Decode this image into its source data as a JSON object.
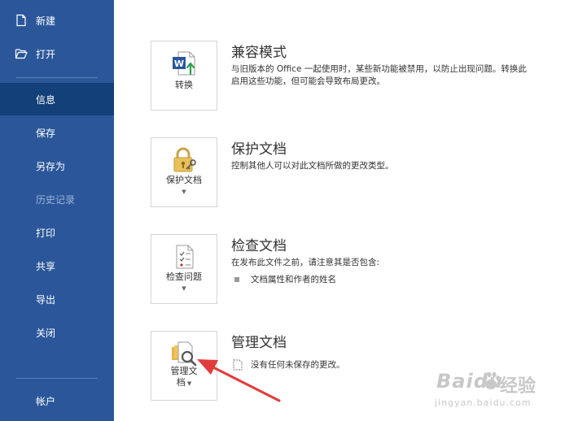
{
  "sidebar": {
    "items": [
      {
        "label": "新建",
        "icon": "new-document-icon"
      },
      {
        "label": "打开",
        "icon": "open-folder-icon"
      },
      {
        "label": "信息",
        "state": "active"
      },
      {
        "label": "保存"
      },
      {
        "label": "另存为"
      },
      {
        "label": "历史记录",
        "state": "disabled"
      },
      {
        "label": "打印"
      },
      {
        "label": "共享"
      },
      {
        "label": "导出"
      },
      {
        "label": "关闭"
      },
      {
        "label": "帐户"
      }
    ]
  },
  "sections": [
    {
      "tile_label": "转换",
      "title": "兼容模式",
      "desc_line1": "与旧版本的 Office 一起使用时，某些新功能被禁用，以防止出现问题。转换此",
      "desc_line2": "启用这些功能，但可能会导致布局更改。"
    },
    {
      "tile_label": "保护文档",
      "title": "保护文档",
      "desc_line1": "控制其他人可以对此文档所做的更改类型。"
    },
    {
      "tile_label": "检查问题",
      "title": "检查文档",
      "desc_line1": "在发布此文件之前，请注意其是否包含:",
      "bullet": "文档属性和作者的姓名"
    },
    {
      "tile_label_line1": "管理文",
      "tile_label_line2": "档",
      "title": "管理文档",
      "bullet": "没有任何未保存的更改。"
    }
  ],
  "watermark": {
    "brand": "Baidu",
    "brand_cn": "经验",
    "url": "jingyan.baidu.com"
  },
  "colors": {
    "sidebar_bg": "#2b579a",
    "sidebar_active": "#124078",
    "arrow": "#e03c3c"
  }
}
